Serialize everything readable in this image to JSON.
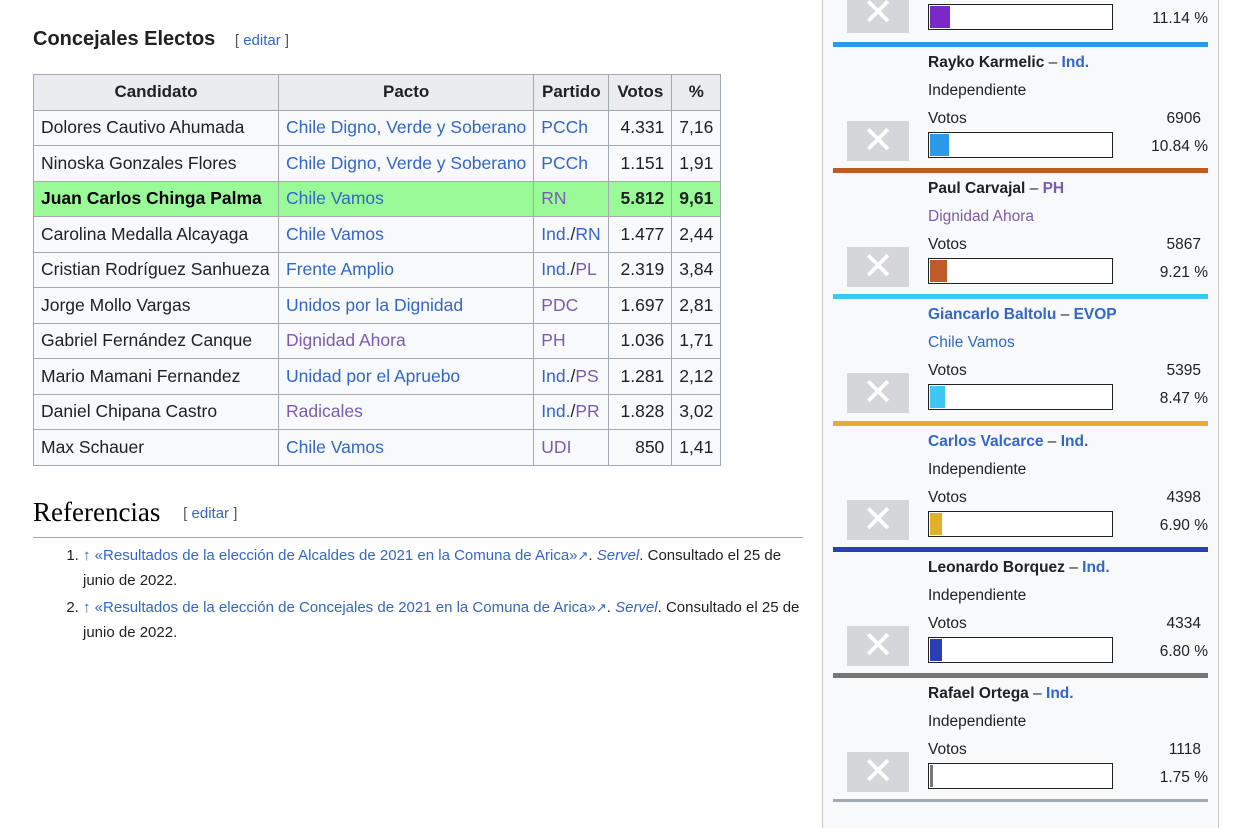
{
  "concejales": {
    "title": "Concejales Electos",
    "edit_open": "[ ",
    "edit_label": "editar",
    "edit_close": " ]",
    "headers": [
      "Candidato",
      "Pacto",
      "Partido",
      "Votos",
      "%"
    ],
    "rows": [
      {
        "name": "Dolores Cautivo Ahumada",
        "pacto": "Chile Digno, Verde y Soberano",
        "partido": "PCCh",
        "votos": "4.331",
        "pct": "7,16"
      },
      {
        "name": "Ninoska Gonzales Flores",
        "pacto": "Chile Digno, Verde y Soberano",
        "partido": "PCCh",
        "votos": "1.151",
        "pct": "1,91"
      },
      {
        "name": "Juan Carlos Chinga Palma",
        "pacto": "Chile Vamos",
        "partido": "RN",
        "votos": "5.812",
        "pct": "9,61"
      },
      {
        "name": "Carolina Medalla Alcayaga",
        "pacto": "Chile Vamos",
        "partido_a": "Ind.",
        "partido_b": "RN",
        "votos": "1.477",
        "pct": "2,44"
      },
      {
        "name": "Cristian Rodríguez Sanhueza",
        "pacto": "Frente Amplio",
        "partido_a": "Ind.",
        "partido_b": "PL",
        "votos": "2.319",
        "pct": "3,84"
      },
      {
        "name": "Jorge Mollo Vargas",
        "pacto": "Unidos por la Dignidad",
        "partido": "PDC",
        "votos": "1.697",
        "pct": "2,81"
      },
      {
        "name": "Gabriel Fernández Canque",
        "pacto": "Dignidad Ahora",
        "partido": "PH",
        "votos": "1.036",
        "pct": "1,71"
      },
      {
        "name": "Mario Mamani Fernandez",
        "pacto": "Unidad por el Apruebo",
        "partido_a": "Ind.",
        "partido_b": "PS",
        "votos": "1.281",
        "pct": "2,12"
      },
      {
        "name": "Daniel Chipana Castro",
        "pacto": "Radicales",
        "partido_a": "Ind.",
        "partido_b": "PR",
        "votos": "1.828",
        "pct": "3,02"
      },
      {
        "name": "Max Schauer",
        "pacto": "Chile Vamos",
        "partido": "UDI",
        "votos": "850",
        "pct": "1,41"
      }
    ]
  },
  "referencias": {
    "title": "Referencias",
    "edit_open": "[ ",
    "edit_label": "editar",
    "edit_close": " ]",
    "items": [
      {
        "arrow": "↑",
        "link": "«Resultados de la elección de Alcaldes de 2021 en la Comuna de Arica»",
        "source": "Servel",
        "rest": " Consultado el 25 de junio de 2022."
      },
      {
        "arrow": "↑",
        "link": "«Resultados de la elección de Concejales de 2021 en la Comuna de Arica»",
        "source": "Servel",
        "rest": " Consultado el 25 de junio de 2022."
      }
    ]
  },
  "sidebar": {
    "top_partial": {
      "pct": "11.14 %",
      "color": "#7b28c8",
      "share": 11.14
    },
    "separator": " – ",
    "votes_label": "Votos",
    "photo_glyph": "✕",
    "candidates": [
      {
        "name": "Rayko Karmelic",
        "abbr": "Ind.",
        "tag": "Independiente",
        "votes": "6906",
        "pct": "10.84 %",
        "share": 10.84,
        "color": "#2c9ae6",
        "prev_color": "#2c9ae6",
        "tag_link": false,
        "name_link": false
      },
      {
        "name": "Paul Carvajal",
        "abbr": "PH",
        "tag": "Dignidad Ahora",
        "votes": "5867",
        "pct": "9.21 %",
        "share": 9.21,
        "color": "#bf5a2a",
        "prev_color": "#bf5a2a",
        "tag_link": true,
        "name_link": false
      },
      {
        "name": "Giancarlo Baltolu",
        "abbr": "EVOP",
        "tag": "Chile Vamos",
        "votes": "5395",
        "pct": "8.47 %",
        "share": 8.47,
        "color": "#3ec7f4",
        "prev_color": "#3ec7f4",
        "tag_link": true,
        "name_link": true
      },
      {
        "name": "Carlos Valcarce",
        "abbr": "Ind.",
        "tag": "Independiente",
        "votes": "4398",
        "pct": "6.90 %",
        "share": 6.9,
        "color": "#e2b12a",
        "prev_color": "#e2b12a",
        "tag_link": false,
        "name_link": true
      },
      {
        "name": "Leonardo Borquez",
        "abbr": "Ind.",
        "tag": "Independiente",
        "votes": "4334",
        "pct": "6.80 %",
        "share": 6.8,
        "color": "#2a3fb5",
        "prev_color": "#2a3fb5",
        "tag_link": false,
        "name_link": false
      },
      {
        "name": "Rafael Ortega",
        "abbr": "Ind.",
        "tag": "Independiente",
        "votes": "1118",
        "pct": "1.75 %",
        "share": 1.75,
        "color": "#777777",
        "prev_color": "#777777",
        "tag_link": false,
        "name_link": false
      }
    ]
  }
}
